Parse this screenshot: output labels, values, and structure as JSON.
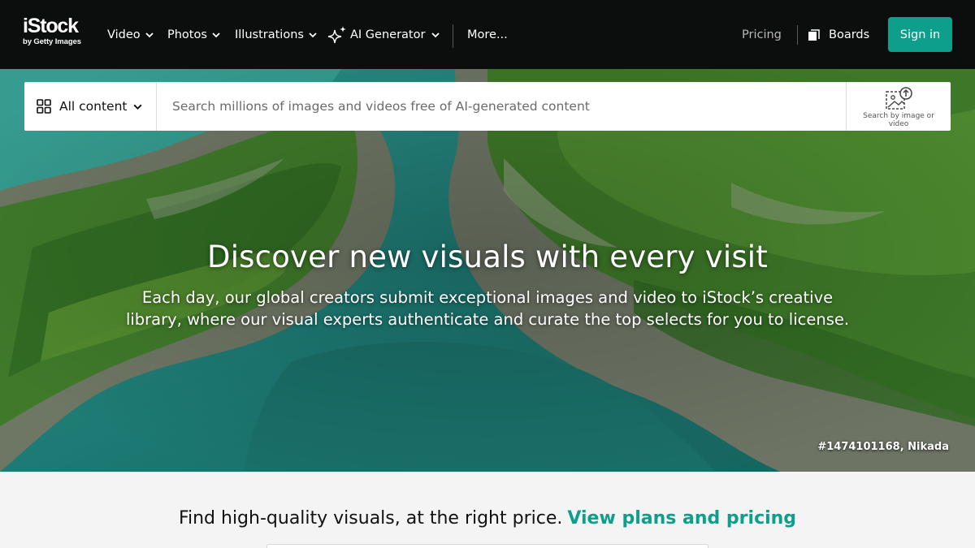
{
  "brand": {
    "name": "iStock",
    "tagline": "by Getty Images"
  },
  "nav": {
    "items": [
      {
        "label": "Video"
      },
      {
        "label": "Photos"
      },
      {
        "label": "Illustrations"
      },
      {
        "label": "AI Generator"
      },
      {
        "label": "More..."
      }
    ],
    "pricing": "Pricing",
    "boards": "Boards",
    "sign_in": "Sign in"
  },
  "search": {
    "content_type": "All content",
    "placeholder": "Search millions of images and videos free of AI-generated content",
    "visual_search_label": "Search by image or video"
  },
  "hero": {
    "title": "Discover new visuals with every visit",
    "subtitle": "Each day, our global creators submit exceptional images and video to iStock’s creative library, where our visual experts authenticate and curate the top selects for you to license.",
    "credit": "#1474101168, Nikada"
  },
  "promo": {
    "text": "Find high-quality visuals, at the right price.",
    "link": "View plans and pricing"
  },
  "colors": {
    "accent": "#0d9e8c",
    "topbar": "#0c0d0d",
    "water": "#1f7a73",
    "foliage": "#3f7a2a"
  },
  "icons": [
    "chevron-down-icon",
    "sparkle-icon",
    "boards-icon",
    "grid-icon",
    "image-upload-icon"
  ]
}
